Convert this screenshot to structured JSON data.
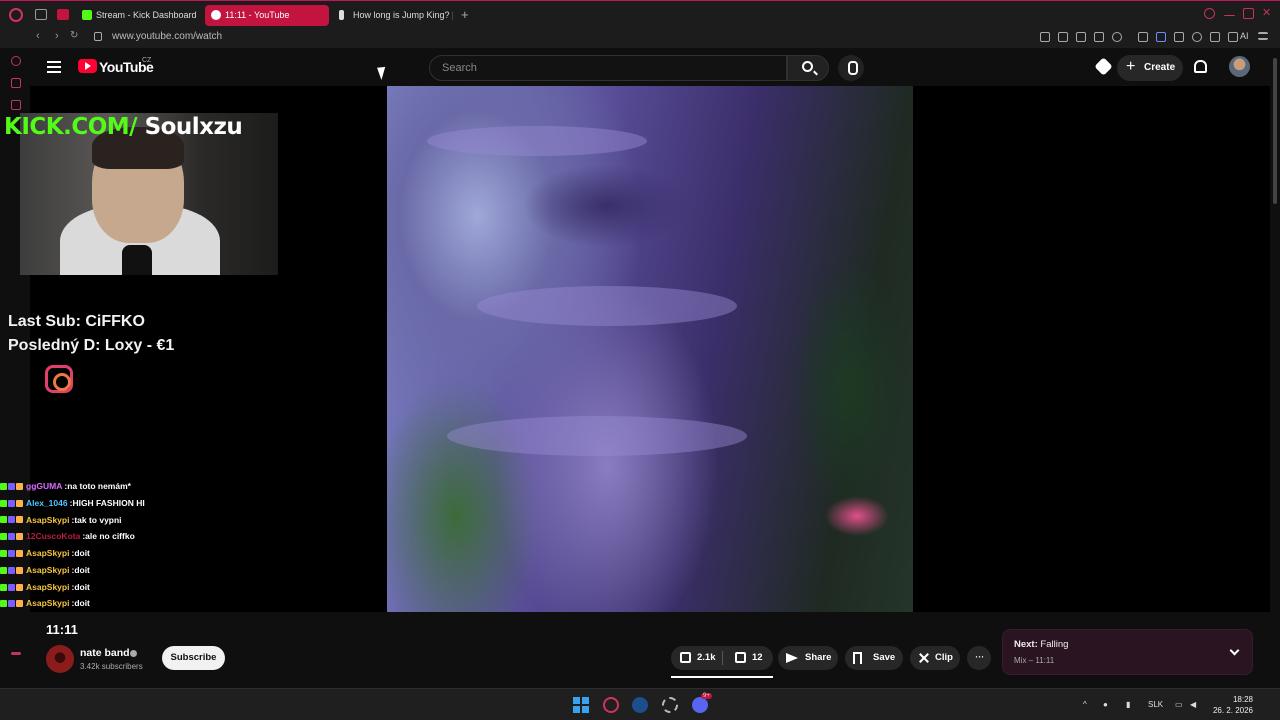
{
  "browser": {
    "tabs": [
      {
        "label": "Stream - Kick Dashboard",
        "active": false
      },
      {
        "label": "11:11 - YouTube",
        "active": true
      },
      {
        "label": "How long is Jump King? |",
        "active": false
      }
    ],
    "new_tab_label": "+",
    "url": "www.youtube.com/watch",
    "ai_label": "AI"
  },
  "youtube": {
    "wordmark": "YouTube",
    "country": "CZ",
    "search_placeholder": "Search",
    "create_label": "Create"
  },
  "overlay": {
    "kick_prefix": "KICK.COM/",
    "kick_user": "Soulxzu",
    "last_sub": "Last Sub: CiFFKO",
    "last_donation": "Posledný D: Loxy - €1",
    "chat": [
      {
        "user": "ggGUMA",
        "msg": "na toto nemám*",
        "color": "#d86cff"
      },
      {
        "user": "Alex_1046",
        "msg": "HIGH FASHION HI",
        "color": "#4ec5ff"
      },
      {
        "user": "AsapSkypi",
        "msg": "tak to vypni",
        "color": "#f5c542"
      },
      {
        "user": "12CuscoKota",
        "msg": "ale no ciffko",
        "color": "#b51e3d"
      },
      {
        "user": "AsapSkypi",
        "msg": "doit",
        "color": "#f5c542"
      },
      {
        "user": "AsapSkypi",
        "msg": "doit",
        "color": "#f5c542"
      },
      {
        "user": "AsapSkypi",
        "msg": "doit",
        "color": "#f5c542"
      },
      {
        "user": "AsapSkypi",
        "msg": "doit",
        "color": "#f5c542"
      }
    ]
  },
  "video": {
    "title": "11:11",
    "channel": "nate band",
    "subscribers": "3.42k subscribers",
    "subscribe_label": "Subscribe",
    "likes": "2.1k",
    "dislikes": "12",
    "share_label": "Share",
    "save_label": "Save",
    "clip_label": "Clip",
    "more_label": "···"
  },
  "next": {
    "prefix": "Next:",
    "title": "Falling",
    "subtitle": "Mix – 11:11"
  },
  "taskbar": {
    "language": "SLK",
    "time": "18:28",
    "date": "26. 2. 2026",
    "discord_badge": "9+"
  },
  "colors": {
    "accent": "#c3133f",
    "kick_green": "#53fc18",
    "yt_red": "#ff0033"
  }
}
